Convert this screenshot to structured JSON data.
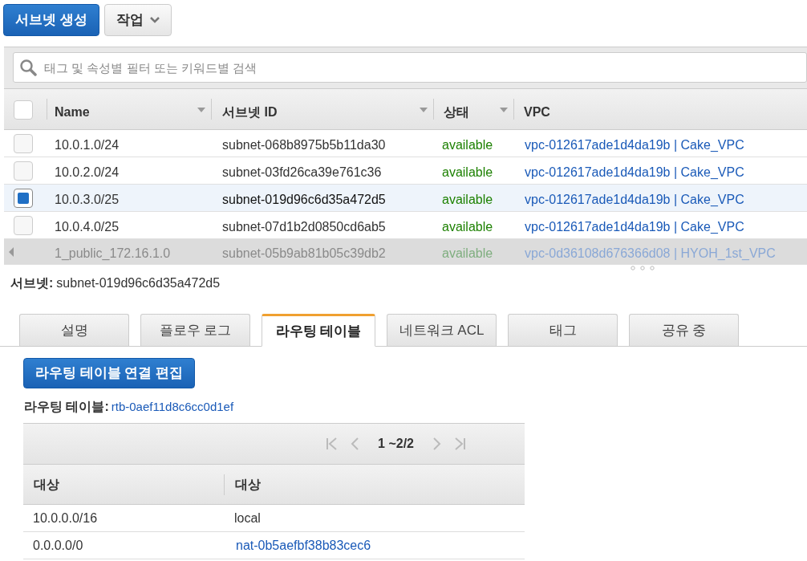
{
  "toolbar": {
    "create_button": "서브넷 생성",
    "actions_button": "작업"
  },
  "search": {
    "placeholder": "태그 및 속성별 필터 또는 키워드별 검색"
  },
  "table": {
    "select_all_checked": false,
    "columns": [
      {
        "label": "Name",
        "sortable": true
      },
      {
        "label": "서브넷 ID",
        "sortable": true
      },
      {
        "label": "상태",
        "sortable": true
      },
      {
        "label": "VPC",
        "sortable": false
      }
    ],
    "rows": [
      {
        "name": "10.0.1.0/24",
        "subnet_id": "subnet-068b8975b5b11da30",
        "state": "available",
        "vpc": "vpc-012617ade1d4da19b | Cake_VPC",
        "selected": false,
        "dimmed": false
      },
      {
        "name": "10.0.2.0/24",
        "subnet_id": "subnet-03fd26ca39e761c36",
        "state": "available",
        "vpc": "vpc-012617ade1d4da19b | Cake_VPC",
        "selected": false,
        "dimmed": false
      },
      {
        "name": "10.0.3.0/25",
        "subnet_id": "subnet-019d96c6d35a472d5",
        "state": "available",
        "vpc": "vpc-012617ade1d4da19b | Cake_VPC",
        "selected": true,
        "dimmed": false
      },
      {
        "name": "10.0.4.0/25",
        "subnet_id": "subnet-07d1b2d0850cd6ab5",
        "state": "available",
        "vpc": "vpc-012617ade1d4da19b | Cake_VPC",
        "selected": false,
        "dimmed": false
      },
      {
        "name": "1_public_172.16.1.0",
        "subnet_id": "subnet-05b9ab81b05c39db2",
        "state": "available",
        "vpc": "vpc-0d36108d676366d08 | HYOH_1st_VPC",
        "selected": false,
        "dimmed": true
      }
    ]
  },
  "detail": {
    "label": "서브넷:",
    "value": "subnet-019d96c6d35a472d5"
  },
  "tabs": [
    {
      "label": "설명",
      "selected": false
    },
    {
      "label": "플로우 로그",
      "selected": false
    },
    {
      "label": "라우팅 테이블",
      "selected": true
    },
    {
      "label": "네트워크 ACL",
      "selected": false
    },
    {
      "label": "태그",
      "selected": false
    },
    {
      "label": "공유 중",
      "selected": false
    }
  ],
  "route": {
    "edit_button": "라우팅 테이블 연결 편집",
    "label": "라우팅 테이블:",
    "value": "rtb-0aef11d8c6cc0d1ef",
    "pagination": "1 ~2/2",
    "columns": [
      "대상",
      "대상"
    ],
    "rows": [
      {
        "destination": "10.0.0.0/16",
        "target": "local",
        "link": false
      },
      {
        "destination": "0.0.0.0/0",
        "target": "nat-0b5aefbf38b83cec6",
        "link": true
      }
    ]
  }
}
